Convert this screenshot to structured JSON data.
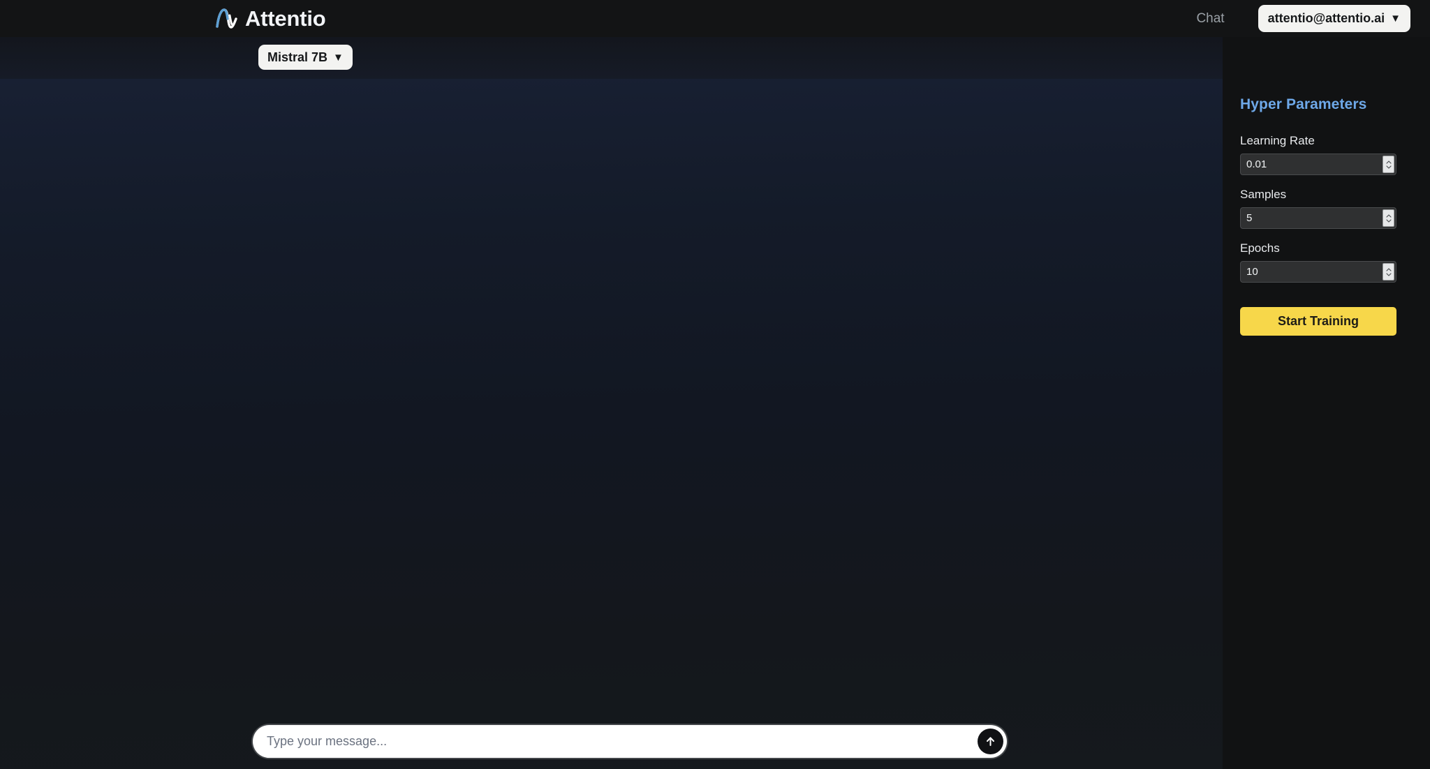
{
  "header": {
    "brand_name": "Attentio",
    "brand_logo_icon": "attentio-wave-logo",
    "nav_chat_label": "Chat",
    "account_email": "attentio@attentio.ai",
    "account_caret_icon": "caret-down-icon"
  },
  "model_bar": {
    "selected_model": "Mistral 7B",
    "caret_icon": "caret-down-icon"
  },
  "chat": {
    "messages": [],
    "composer": {
      "value": "",
      "placeholder": "Type your message...",
      "send_icon": "arrow-up-icon"
    }
  },
  "sidebar": {
    "title": "Hyper Parameters",
    "title_color": "#6ea8e8",
    "fields": [
      {
        "label": "Learning Rate",
        "value": "0.01",
        "spinner_icon": "spinner-up-down-icon"
      },
      {
        "label": "Samples",
        "value": "5",
        "spinner_icon": "spinner-up-down-icon"
      },
      {
        "label": "Epochs",
        "value": "10",
        "spinner_icon": "spinner-up-down-icon"
      }
    ],
    "start_button_label": "Start Training",
    "start_button_color": "#f7d74a"
  }
}
